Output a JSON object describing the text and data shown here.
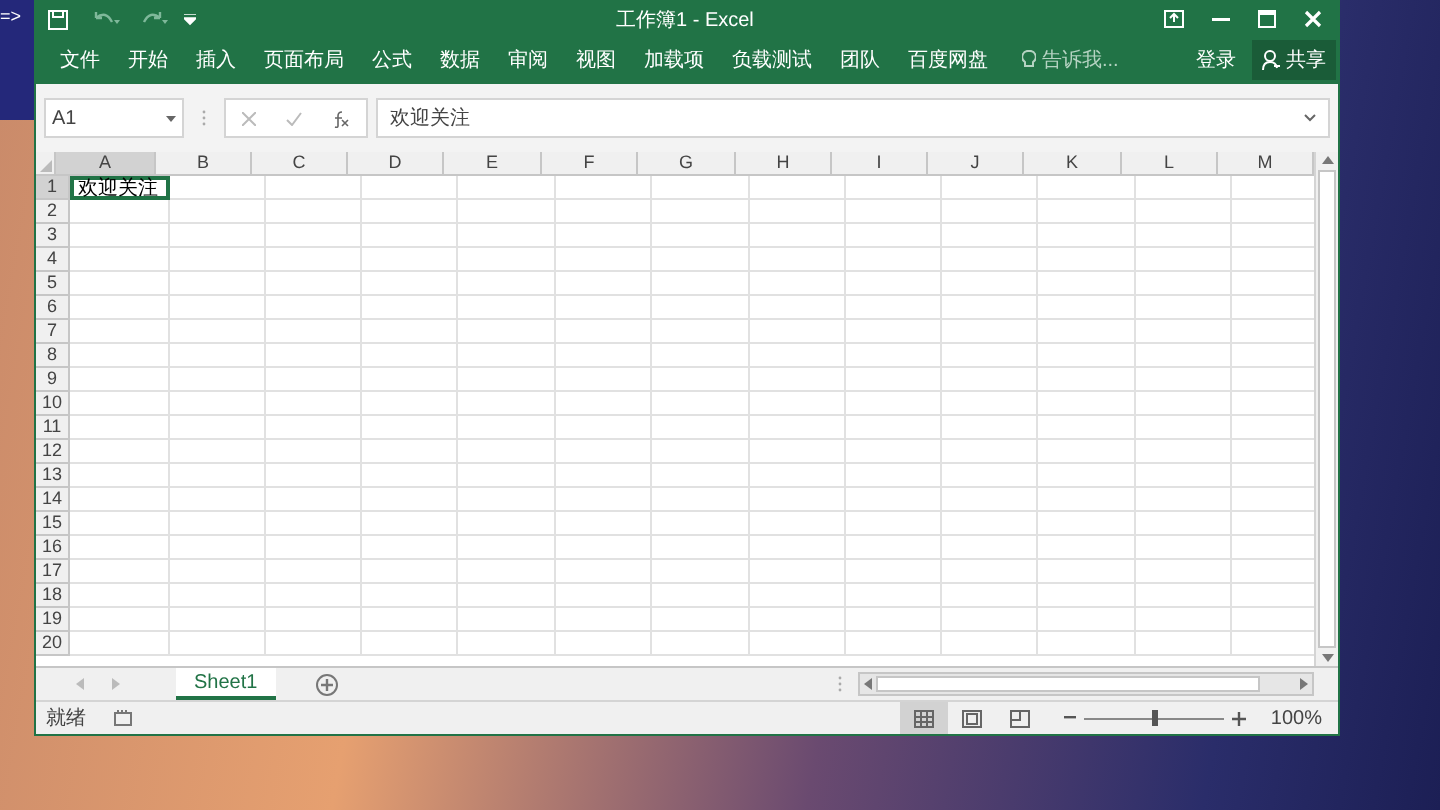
{
  "background_window": {
    "text": "=>"
  },
  "window": {
    "title": "工作簿1 - Excel"
  },
  "ribbon_tabs": [
    {
      "label": "文件",
      "selected": false
    },
    {
      "label": "开始",
      "selected": false
    },
    {
      "label": "插入",
      "selected": false
    },
    {
      "label": "页面布局",
      "selected": false
    },
    {
      "label": "公式",
      "selected": false
    },
    {
      "label": "数据",
      "selected": false
    },
    {
      "label": "审阅",
      "selected": false
    },
    {
      "label": "视图",
      "selected": false
    },
    {
      "label": "加载项",
      "selected": false
    },
    {
      "label": "负载测试",
      "selected": false
    },
    {
      "label": "团队",
      "selected": false
    },
    {
      "label": "百度网盘",
      "selected": false
    }
  ],
  "tell_me": {
    "placeholder": "告诉我..."
  },
  "sign_in": "登录",
  "share": "共享",
  "name_box": {
    "value": "A1"
  },
  "formula_bar": {
    "value": "欢迎关注"
  },
  "columns": [
    "A",
    "B",
    "C",
    "D",
    "E",
    "F",
    "G",
    "H",
    "I",
    "J",
    "K",
    "L",
    "M"
  ],
  "rows": [
    {
      "header": "1",
      "cells": [
        {
          "text": "欢迎关注",
          "selected": true
        }
      ]
    },
    {
      "header": "2"
    },
    {
      "header": "3"
    },
    {
      "header": "4"
    },
    {
      "header": "5"
    },
    {
      "header": "6"
    },
    {
      "header": "7"
    },
    {
      "header": "8"
    },
    {
      "header": "9"
    },
    {
      "header": "10"
    },
    {
      "header": "11"
    },
    {
      "header": "12"
    },
    {
      "header": "13"
    },
    {
      "header": "14"
    },
    {
      "header": "15"
    },
    {
      "header": "16"
    },
    {
      "header": "17"
    },
    {
      "header": "18"
    },
    {
      "header": "19"
    },
    {
      "header": "20"
    }
  ],
  "sheet_tabs": [
    {
      "label": "Sheet1",
      "selected": true
    }
  ],
  "status_bar": {
    "status": "就绪",
    "views": [
      {
        "kind": "normal",
        "selected": true
      },
      {
        "kind": "page-layout",
        "selected": false
      },
      {
        "kind": "page-break",
        "selected": false
      }
    ],
    "zoom": {
      "level": 0.5,
      "reading": "100%"
    }
  }
}
